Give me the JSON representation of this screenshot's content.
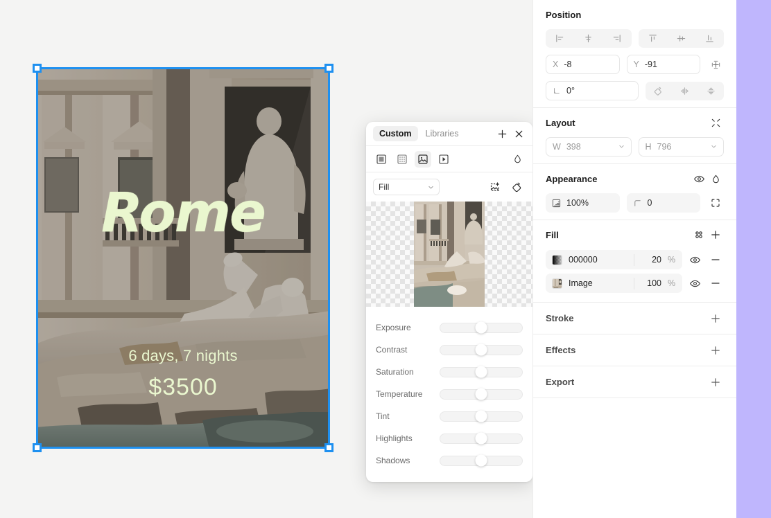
{
  "canvas": {
    "artwork": {
      "title": "Rome",
      "subtitle": "6 days, 7 nights",
      "price": "$3500",
      "text_color": "#eaf7cf",
      "overlay_color": "#000000",
      "overlay_opacity": "20%"
    }
  },
  "image_panel": {
    "tabs": [
      {
        "label": "Custom",
        "active": true
      },
      {
        "label": "Libraries",
        "active": false
      }
    ],
    "add_label": "+",
    "close_label": "×",
    "type_icons": [
      {
        "name": "solid-color-icon",
        "active": false
      },
      {
        "name": "pattern-icon",
        "active": false
      },
      {
        "name": "image-icon",
        "active": true
      },
      {
        "name": "video-icon",
        "active": false
      }
    ],
    "eyedropper_icon": "droplet-icon",
    "fit_select": {
      "value": "Fill"
    },
    "replace_icon": "replace-image-icon",
    "rotate_icon": "rotate-icon",
    "adjustments": [
      {
        "label": "Exposure",
        "value": 50
      },
      {
        "label": "Contrast",
        "value": 50
      },
      {
        "label": "Saturation",
        "value": 50
      },
      {
        "label": "Temperature",
        "value": 50
      },
      {
        "label": "Tint",
        "value": 50
      },
      {
        "label": "Highlights",
        "value": 50
      },
      {
        "label": "Shadows",
        "value": 50
      }
    ]
  },
  "inspector": {
    "position": {
      "title": "Position",
      "align_h": [
        "align-left-icon",
        "align-center-horizontal-icon",
        "align-right-icon"
      ],
      "align_v": [
        "align-top-icon",
        "align-center-vertical-icon",
        "align-bottom-icon"
      ],
      "x": {
        "key": "X",
        "value": "-8"
      },
      "y": {
        "key": "Y",
        "value": "-91"
      },
      "add_icon": "add-position-icon",
      "rotation": {
        "key": "angle",
        "value": "0°"
      },
      "transform_icons": [
        "rotate-icon",
        "flip-horizontal-icon",
        "flip-vertical-icon"
      ]
    },
    "layout": {
      "title": "Layout",
      "collapse_icon": "collapse-icon",
      "w": {
        "key": "W",
        "value": "398"
      },
      "h": {
        "key": "H",
        "value": "796"
      }
    },
    "appearance": {
      "title": "Appearance",
      "visibility_icon": "eye-icon",
      "blend_icon": "droplet-icon",
      "opacity": "100%",
      "corner_radius": "0",
      "corners_icon": "independent-corners-icon"
    },
    "fill": {
      "title": "Fill",
      "styles_icon": "fill-styles-icon",
      "add_icon": "add-fill-icon",
      "rows": [
        {
          "swatch_type": "color",
          "color": "#000000",
          "name": "000000",
          "value": "20",
          "unit": "%",
          "visible_icon": "eye-icon",
          "remove_icon": "remove-icon",
          "selected": false
        },
        {
          "swatch_type": "image",
          "name": "Image",
          "value": "100",
          "unit": "%",
          "visible_icon": "eye-icon",
          "remove_icon": "remove-icon",
          "selected": true
        }
      ]
    },
    "sections": [
      {
        "title": "Stroke",
        "add_icon": "add-stroke-icon"
      },
      {
        "title": "Effects",
        "add_icon": "add-effect-icon"
      },
      {
        "title": "Export",
        "add_icon": "add-export-icon"
      }
    ]
  },
  "theme": {
    "background": "#f4f4f3",
    "panel": "#ffffff",
    "selection": "#1e90f0",
    "accent_strip": "#bfb6fd"
  }
}
